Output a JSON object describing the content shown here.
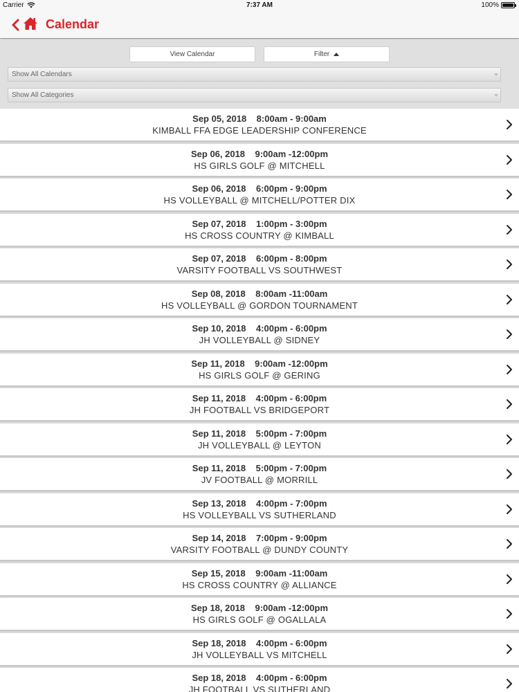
{
  "status_bar": {
    "carrier": "Carrier",
    "time": "7:37 AM",
    "battery": "100%"
  },
  "nav": {
    "title": "Calendar",
    "back_icon": "chevron-left-icon",
    "home_icon": "home-icon",
    "accent_color": "#d9252b"
  },
  "controls": {
    "view_calendar_label": "View Calendar",
    "filter_label": "Filter",
    "calendars_dropdown": "Show All Calendars",
    "categories_dropdown": "Show All Categories"
  },
  "events": [
    {
      "date": "Sep 05, 2018",
      "time": "8:00am - 9:00am",
      "title": "KIMBALL FFA EDGE LEADERSHIP CONFERENCE"
    },
    {
      "date": "Sep 06, 2018",
      "time": "9:00am -12:00pm",
      "title": "HS GIRLS GOLF @ MITCHELL"
    },
    {
      "date": "Sep 06, 2018",
      "time": "6:00pm - 9:00pm",
      "title": "HS VOLLEYBALL @ MITCHELL/POTTER DIX"
    },
    {
      "date": "Sep 07, 2018",
      "time": "1:00pm - 3:00pm",
      "title": "HS CROSS COUNTRY @ KIMBALL"
    },
    {
      "date": "Sep 07, 2018",
      "time": "6:00pm - 8:00pm",
      "title": "VARSITY FOOTBALL VS SOUTHWEST"
    },
    {
      "date": "Sep 08, 2018",
      "time": "8:00am -11:00am",
      "title": "HS VOLLEYBALL @ GORDON TOURNAMENT"
    },
    {
      "date": "Sep 10, 2018",
      "time": "4:00pm - 6:00pm",
      "title": "JH VOLLEYBALL @ SIDNEY"
    },
    {
      "date": "Sep 11, 2018",
      "time": "9:00am -12:00pm",
      "title": "HS GIRLS GOLF @ GERING"
    },
    {
      "date": "Sep 11, 2018",
      "time": "4:00pm - 6:00pm",
      "title": "JH FOOTBALL VS BRIDGEPORT"
    },
    {
      "date": "Sep 11, 2018",
      "time": "5:00pm - 7:00pm",
      "title": "JH VOLLEYBALL @ LEYTON"
    },
    {
      "date": "Sep 11, 2018",
      "time": "5:00pm - 7:00pm",
      "title": "JV FOOTBALL @ MORRILL"
    },
    {
      "date": "Sep 13, 2018",
      "time": "4:00pm - 7:00pm",
      "title": "HS VOLLEYBALL VS SUTHERLAND"
    },
    {
      "date": "Sep 14, 2018",
      "time": "7:00pm - 9:00pm",
      "title": "VARSITY FOOTBALL @ DUNDY COUNTY"
    },
    {
      "date": "Sep 15, 2018",
      "time": "9:00am -11:00am",
      "title": "HS CROSS COUNTRY @ ALLIANCE"
    },
    {
      "date": "Sep 18, 2018",
      "time": "9:00am -12:00pm",
      "title": "HS GIRLS GOLF @ OGALLALA"
    },
    {
      "date": "Sep 18, 2018",
      "time": "4:00pm - 6:00pm",
      "title": "JH VOLLEYBALL VS MITCHELL"
    },
    {
      "date": "Sep 18, 2018",
      "time": "4:00pm - 6:00pm",
      "title": "JH FOOTBALL VS SUTHERLAND"
    }
  ]
}
